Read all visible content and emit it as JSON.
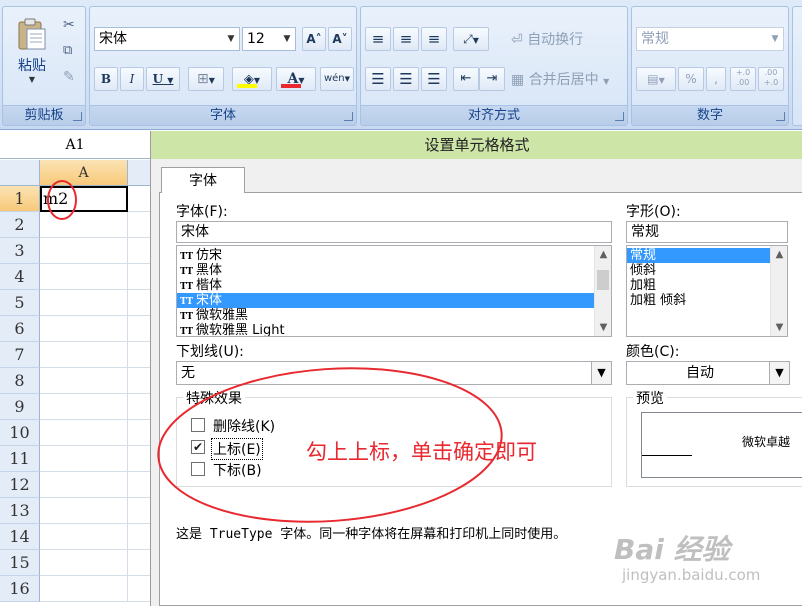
{
  "ribbon": {
    "clipboard": {
      "paste_label": "粘贴",
      "group_label": "剪贴板"
    },
    "font": {
      "font_name": "宋体",
      "font_size": "12",
      "bold": "B",
      "italic": "I",
      "underline": "U",
      "font_color_glyph": "A",
      "increase_font": "A˄",
      "decrease_font": "A˅",
      "phonetic": "wén",
      "group_label": "字体"
    },
    "alignment": {
      "wrap_text": "自动换行",
      "merge_center": "合并后居中",
      "group_label": "对齐方式"
    },
    "number": {
      "format": "常规",
      "percent": "%",
      "comma": ",",
      "inc_decimal": "+.0 .00",
      "dec_decimal": ".00 +.0",
      "group_label": "数字"
    }
  },
  "sheet": {
    "name_box": "A1",
    "column_header": "A",
    "rows": [
      "1",
      "2",
      "3",
      "4",
      "5",
      "6",
      "7",
      "8",
      "9",
      "10",
      "11",
      "12",
      "13",
      "14",
      "15",
      "16"
    ],
    "a1_value": "m2"
  },
  "dialog": {
    "title": "设置单元格格式",
    "tab_font": "字体",
    "font_label": "字体(F):",
    "font_value": "宋体",
    "font_list": [
      "仿宋",
      "黑体",
      "楷体",
      "宋体",
      "微软雅黑",
      "微软雅黑 Light"
    ],
    "font_selected_index": 3,
    "style_label": "字形(O):",
    "style_value": "常规",
    "style_list": [
      "常规",
      "倾斜",
      "加粗",
      "加粗 倾斜"
    ],
    "style_selected_index": 0,
    "underline_label": "下划线(U):",
    "underline_value": "无",
    "color_label": "颜色(C):",
    "color_value": "自动",
    "effects_label": "特殊效果",
    "strikethrough_label": "删除线(K)",
    "superscript_label": "上标(E)",
    "subscript_label": "下标(B)",
    "strikethrough_checked": false,
    "superscript_checked": true,
    "subscript_checked": false,
    "preview_label": "预览",
    "preview_text": "微软卓越",
    "info_text": "这是 TrueType 字体。同一种字体将在屏幕和打印机上同时使用。"
  },
  "annotation": {
    "text": "勾上上标，单击确定即可",
    "color": "#e8292f"
  },
  "watermark": {
    "brand": "Bai 经验",
    "url": "jingyan.baidu.com"
  }
}
